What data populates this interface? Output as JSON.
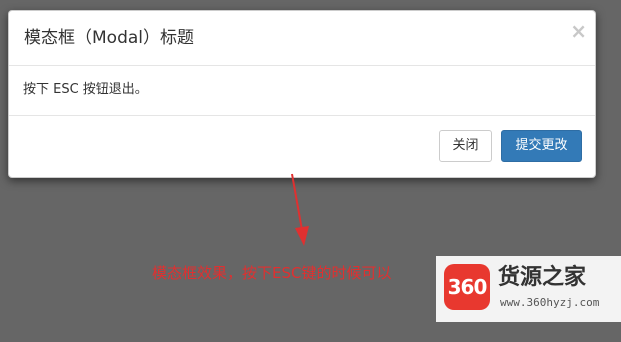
{
  "modal": {
    "title": "模态框（Modal）标题",
    "close_glyph": "×",
    "body_text": "按下 ESC 按钮退出。",
    "close_button_label": "关闭",
    "submit_button_label": "提交更改"
  },
  "annotation": {
    "text": "模态框效果，按下ESC键的时候可以"
  },
  "watermark": {
    "logo_text": "360",
    "name": "货源之家",
    "url": "www.360hyzj.com"
  },
  "colors": {
    "backdrop": "#666666",
    "primary": "#337ab7",
    "annotation": "#e03030",
    "logo": "#e8382f"
  }
}
